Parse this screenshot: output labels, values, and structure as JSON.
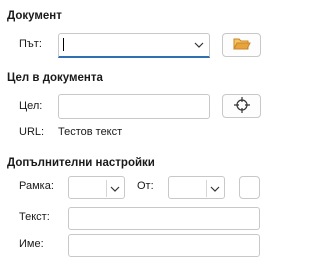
{
  "document": {
    "section_title": "Документ",
    "path_label": "Път:",
    "path_value": "",
    "browse_icon": "folder-open-icon"
  },
  "target": {
    "section_title": "Цел в документа",
    "target_label": "Цел:",
    "target_value": "",
    "target_icon": "crosshair-icon",
    "url_label": "URL:",
    "url_value": "Тестов текст"
  },
  "further": {
    "section_title": "Допълнителни настройки",
    "frame_label": "Рамка:",
    "frame_value": "",
    "form_label": "От:",
    "form_value": "",
    "text_label": "Текст:",
    "text_value": "",
    "name_label": "Име:",
    "name_value": ""
  },
  "colors": {
    "focus_accent": "#2f6fb3",
    "folder_icon": "#e8a33a"
  }
}
